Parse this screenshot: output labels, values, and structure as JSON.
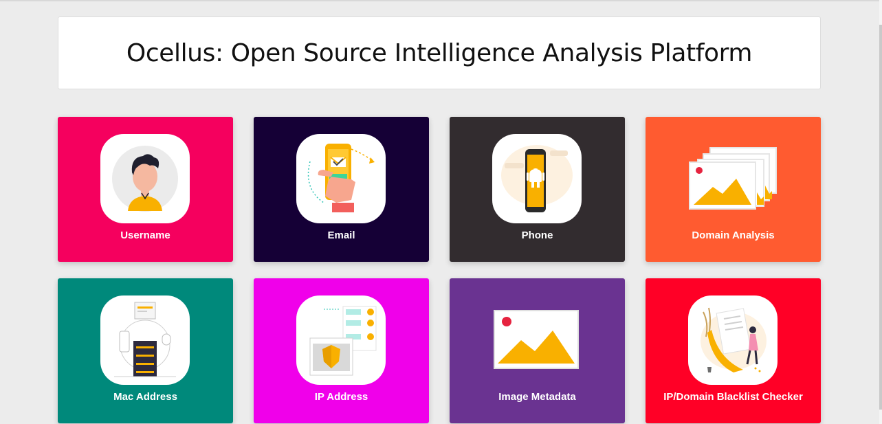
{
  "page": {
    "title": "Ocellus: Open Source Intelligence Analysis Platform"
  },
  "colors": {
    "background": "#ececec",
    "accent_yellow": "#f9b000",
    "accent_red": "#e6233f"
  },
  "cards": [
    {
      "label": "Username",
      "color": "#f5005e",
      "icon": "user-avatar-icon"
    },
    {
      "label": "Email",
      "color": "#150036",
      "icon": "email-phone-icon"
    },
    {
      "label": "Phone",
      "color": "#322c2f",
      "icon": "android-phone-icon"
    },
    {
      "label": "Domain Analysis",
      "color": "#ff5b30",
      "icon": "image-gallery-icon"
    },
    {
      "label": "Mac Address",
      "color": "#00897b",
      "icon": "network-server-icon"
    },
    {
      "label": "IP Address",
      "color": "#f000ea",
      "icon": "shield-server-icon"
    },
    {
      "label": "Image Metadata",
      "color": "#6a3391",
      "icon": "image-icon"
    },
    {
      "label": "IP/Domain Blacklist Checker",
      "color": "#ff0026",
      "icon": "blacklist-document-icon"
    }
  ]
}
